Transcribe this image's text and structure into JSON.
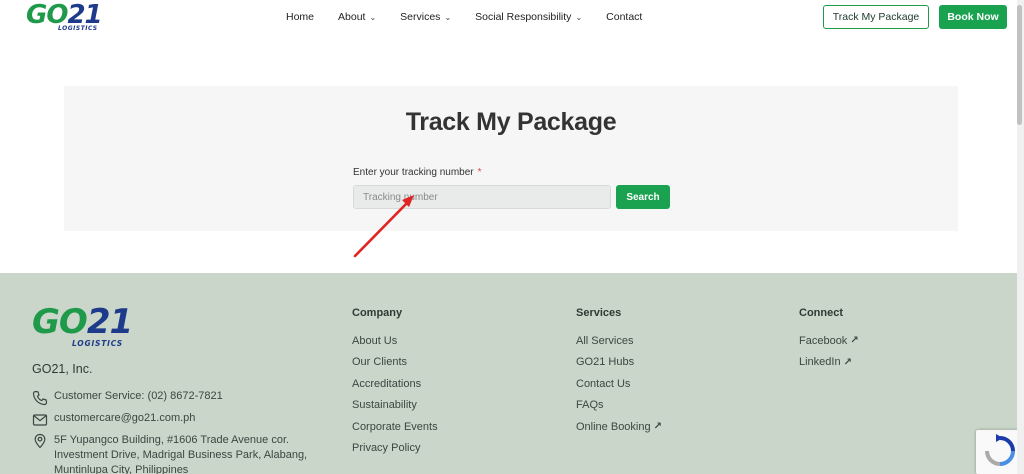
{
  "header": {
    "logo_main_go": "GO",
    "logo_main_21": "21",
    "logo_sub": "LOGISTICS",
    "nav": [
      {
        "label": "Home"
      },
      {
        "label": "About"
      },
      {
        "label": "Services"
      },
      {
        "label": "Social Responsibility"
      },
      {
        "label": "Contact"
      }
    ],
    "track_button": "Track My Package",
    "book_button": "Book Now"
  },
  "main": {
    "title": "Track My Package",
    "field_label": "Enter your tracking number",
    "required_mark": "*",
    "input_placeholder": "Tracking number",
    "input_value": "",
    "search_button": "Search"
  },
  "footer": {
    "logo_go": "GO",
    "logo_21": "21",
    "logo_sub": "LOGISTICS",
    "company_name": "GO21, Inc.",
    "phone": "Customer Service: (02) 8672-7821",
    "email": "customercare@go21.com.ph",
    "address": "5F Yupangco Building, #1606 Trade Avenue cor. Investment Drive, Madrigal Business Park, Alabang, Muntinlupa City, Philippines",
    "company": {
      "title": "Company",
      "links": [
        "About Us",
        "Our Clients",
        "Accreditations",
        "Sustainability",
        "Corporate Events",
        "Privacy Policy"
      ]
    },
    "services": {
      "title": "Services",
      "links": [
        "All Services",
        "GO21 Hubs",
        "Contact Us",
        "FAQs",
        "Online Booking"
      ]
    },
    "connect": {
      "title": "Connect",
      "links": [
        "Facebook",
        "LinkedIn"
      ]
    }
  },
  "colors": {
    "brand_green": "#1aa250",
    "brand_blue": "#1e3a8a",
    "footer_bg": "#c9d6c9",
    "annotation_arrow": "#e02424"
  },
  "icons": {
    "phone": "phone-icon",
    "email": "mail-icon",
    "location": "map-pin-icon",
    "external": "external-link-icon",
    "chevron": "chevron-down-icon"
  }
}
